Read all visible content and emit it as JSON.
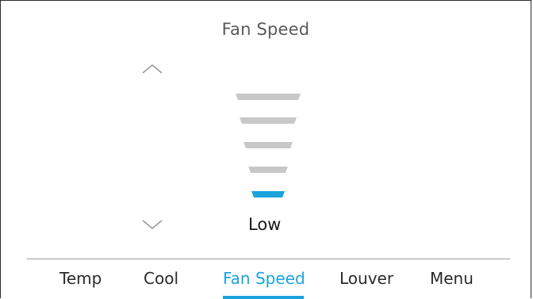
{
  "screen": {
    "title": "Fan Speed"
  },
  "fan_speed": {
    "current_level_label": "Low",
    "level": 1,
    "max_level": 5,
    "colors": {
      "active": "#1aa3dd",
      "inactive": "#c8c8c8"
    }
  },
  "controls": {
    "up_icon": "chevron-up-icon",
    "down_icon": "chevron-down-icon"
  },
  "tabs": [
    {
      "label": "Temp",
      "active": false
    },
    {
      "label": "Cool",
      "active": false
    },
    {
      "label": "Fan Speed",
      "active": true
    },
    {
      "label": "Louver",
      "active": false
    },
    {
      "label": "Menu",
      "active": false
    }
  ]
}
